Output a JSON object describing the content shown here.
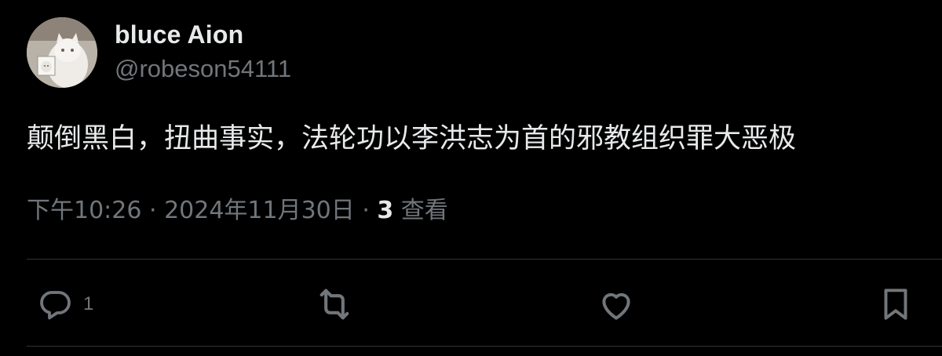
{
  "author": {
    "display_name": "bluce Aion",
    "handle": "@robeson54111"
  },
  "tweet": {
    "text": "颠倒黑白，扭曲事实，法轮功以李洪志为首的邪教组织罪大恶极"
  },
  "meta": {
    "time": "下午10:26",
    "separator1": " · ",
    "date": "2024年11月30日",
    "separator2": " · ",
    "views_count": "3",
    "views_label": " 查看"
  },
  "actions": {
    "reply_count": "1"
  },
  "colors": {
    "background": "#000000",
    "text_primary": "#e7e9ea",
    "text_secondary": "#71767b",
    "divider": "#2f3336"
  },
  "icons": [
    "reply-icon",
    "retweet-icon",
    "like-icon",
    "bookmark-icon"
  ]
}
